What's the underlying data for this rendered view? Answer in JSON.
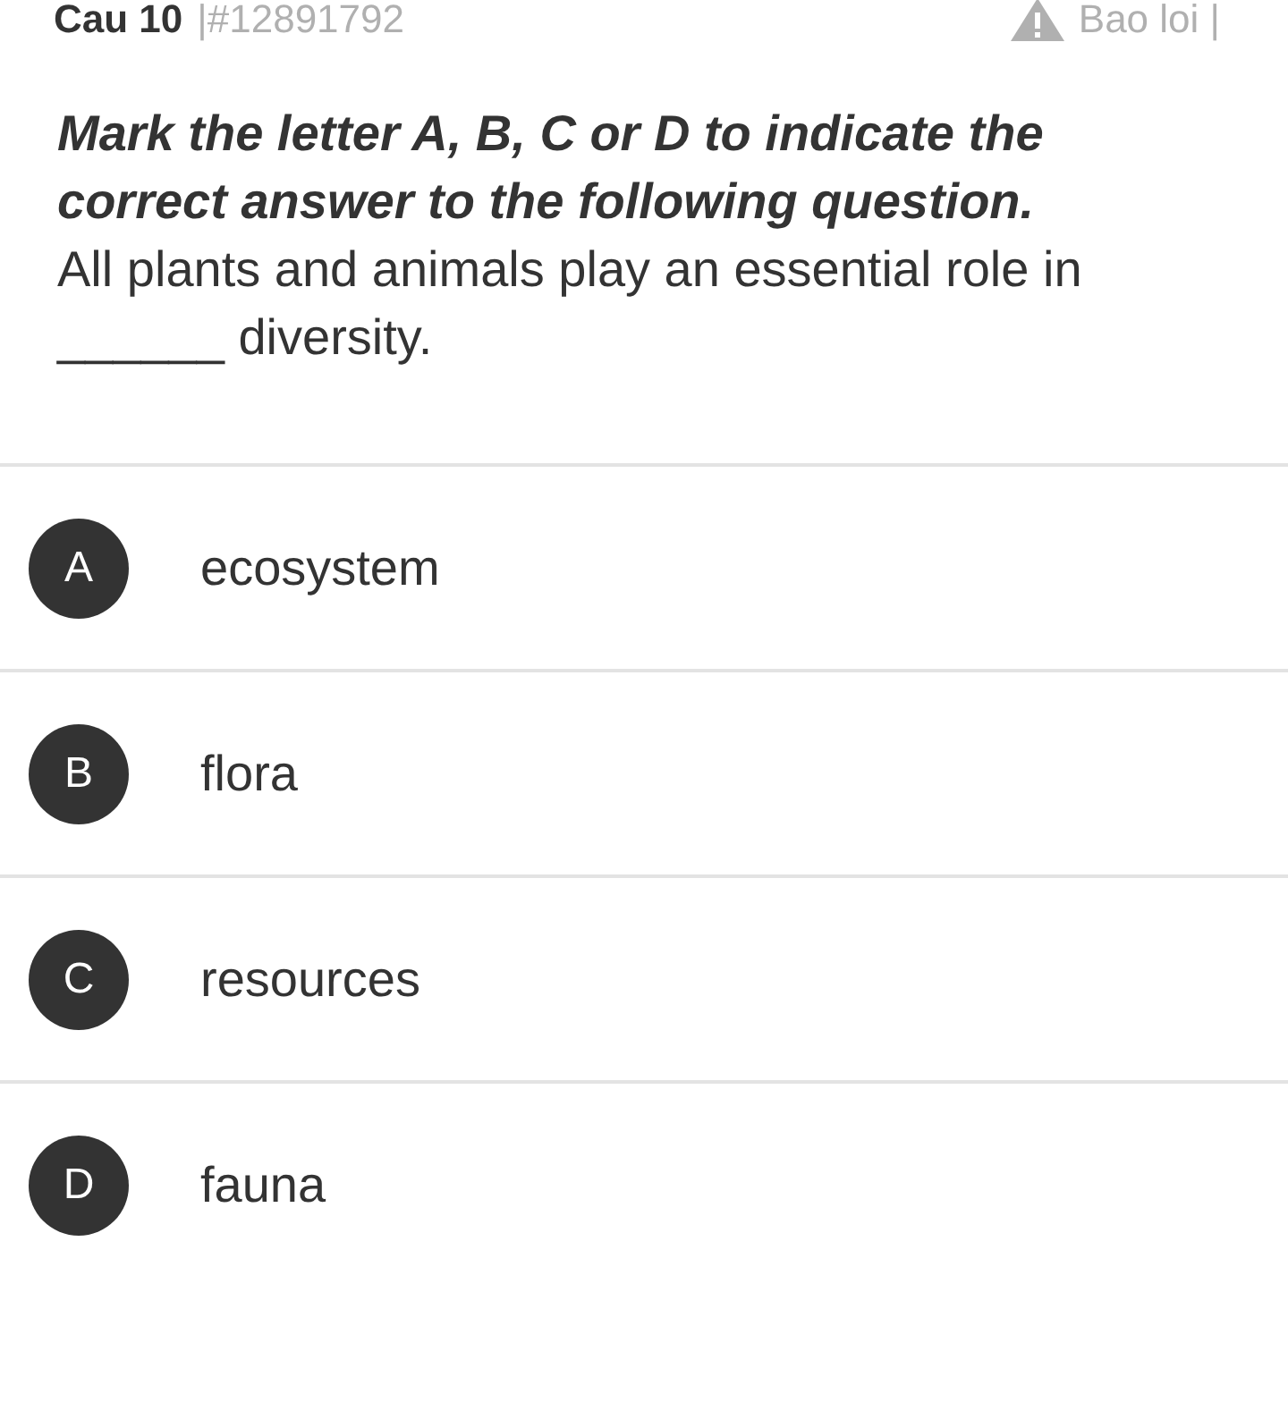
{
  "header": {
    "question_number": "Cau 10",
    "question_id": "|#12891792",
    "report_link": "Bao loi |"
  },
  "question": {
    "instruction": "Mark the letter A, B, C or D to indicate the correct answer to the following question.",
    "text": "All plants and animals play an essential role in ______ diversity."
  },
  "options": [
    {
      "letter": "A",
      "text": "ecosystem"
    },
    {
      "letter": "B",
      "text": "flora"
    },
    {
      "letter": "C",
      "text": "resources"
    },
    {
      "letter": "D",
      "text": "fauna"
    }
  ]
}
